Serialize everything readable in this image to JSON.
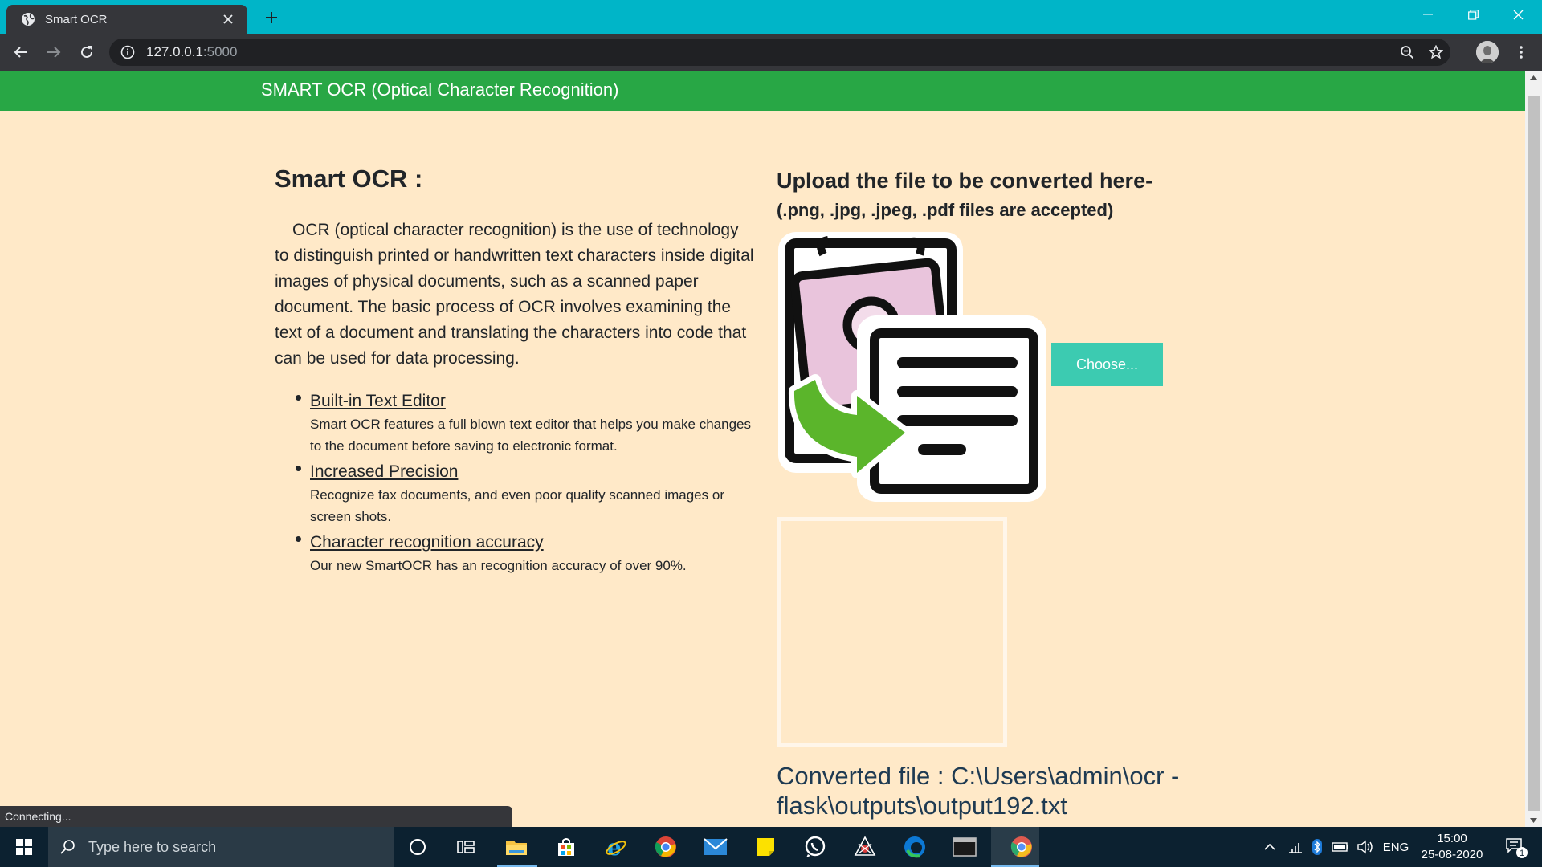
{
  "browser": {
    "tab_title": "Smart OCR",
    "url_host": "127.0.0.1",
    "url_port": ":5000",
    "status_text": "Connecting..."
  },
  "navbar": {
    "brand": "SMART OCR (Optical Character Recognition)"
  },
  "intro": {
    "heading": "Smart OCR :",
    "description": "OCR (optical character recognition) is the use of technology to distinguish printed or handwritten text characters inside digital images of physical documents, such as a scanned paper document. The basic process of OCR involves examining the text of a document and translating the characters into code that can be used for data processing.",
    "features": [
      {
        "title": "Built-in Text Editor",
        "desc": "Smart OCR features a full blown text editor that helps you make changes to the document before saving to electronic format."
      },
      {
        "title": "Increased Precision",
        "desc": "Recognize fax documents, and even poor quality scanned images or screen shots."
      },
      {
        "title": "Character recognition accuracy",
        "desc": "Our new SmartOCR has an recognition accuracy of over 90%."
      }
    ]
  },
  "upload": {
    "title": "Upload the file to be converted here-",
    "subtitle": "(.png, .jpg, .jpeg, .pdf files are accepted)",
    "choose_label": "Choose..."
  },
  "result": {
    "converted_text": "Converted file : C:\\Users\\admin\\ocr - flask\\outputs\\output192.txt"
  },
  "taskbar": {
    "search_placeholder": "Type here to search",
    "language": "ENG",
    "time": "15:00",
    "date": "25-08-2020",
    "notification_count": "1"
  },
  "colors": {
    "tab_bar": "#00b5c8",
    "navbar": "#28a745",
    "page_background": "#ffe9c8",
    "choose_button": "#3ccbb1",
    "converted_text": "#1e3a52"
  }
}
